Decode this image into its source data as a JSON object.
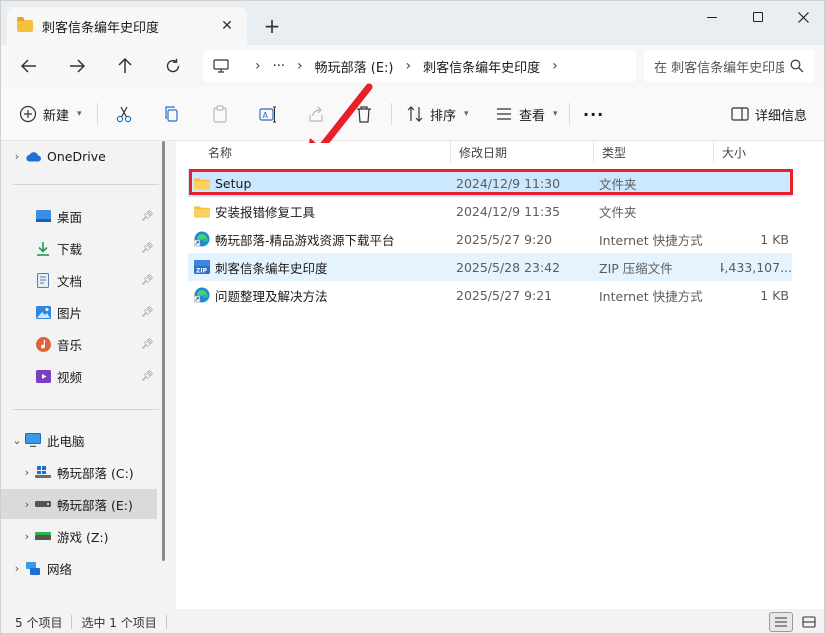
{
  "window": {
    "tab_title": "刺客信条编年史印度",
    "close_tab_glyph": "✕",
    "new_tab_glyph": "+"
  },
  "address": {
    "more_glyph": "···",
    "crumbs": [
      "畅玩部落 (E:)",
      "刺客信条编年史印度"
    ],
    "search_placeholder": "在 刺客信条编年史印度 中搜索"
  },
  "toolbar": {
    "new_label": "新建",
    "sort_label": "排序",
    "view_label": "查看",
    "more_glyph": "···",
    "details_label": "详细信息"
  },
  "sidebar": {
    "onedrive": "OneDrive",
    "quick_access": [
      {
        "label": "桌面",
        "icon": "desktop-icon"
      },
      {
        "label": "下载",
        "icon": "download-icon"
      },
      {
        "label": "文档",
        "icon": "document-icon"
      },
      {
        "label": "图片",
        "icon": "pictures-icon"
      },
      {
        "label": "音乐",
        "icon": "music-icon"
      },
      {
        "label": "视频",
        "icon": "videos-icon"
      }
    ],
    "this_pc": "此电脑",
    "drives": [
      {
        "label": "畅玩部落 (C:)",
        "icon": "windows-drive-icon"
      },
      {
        "label": "畅玩部落 (E:)",
        "icon": "drive-icon"
      },
      {
        "label": "游戏 (Z:)",
        "icon": "drive-icon"
      }
    ],
    "network": "网络"
  },
  "columns": {
    "name": "名称",
    "modified": "修改日期",
    "type": "类型",
    "size": "大小"
  },
  "files": [
    {
      "name": "Setup",
      "modified": "2024/12/9 11:30",
      "type": "文件夹",
      "size": "",
      "icon": "folder-icon"
    },
    {
      "name": "安装报错修复工具",
      "modified": "2024/12/9 11:35",
      "type": "文件夹",
      "size": "",
      "icon": "folder-icon"
    },
    {
      "name": "畅玩部落-精品游戏资源下载平台",
      "modified": "2025/5/27 9:20",
      "type": "Internet 快捷方式",
      "size": "1 KB",
      "icon": "edge-shortcut-icon"
    },
    {
      "name": "刺客信条编年史印度",
      "modified": "2025/5/28 23:42",
      "type": "ZIP 压缩文件",
      "size": "4,433,107...",
      "icon": "zip-icon"
    },
    {
      "name": "问题整理及解决方法",
      "modified": "2025/5/27 9:21",
      "type": "Internet 快捷方式",
      "size": "1 KB",
      "icon": "edge-shortcut-icon"
    }
  ],
  "status": {
    "item_count": "5 个项目",
    "selection": "选中 1 个项目"
  },
  "colors": {
    "highlight_border": "#e8202a",
    "selection_bg": "#cce8ff",
    "folder": "#f5c13d"
  }
}
